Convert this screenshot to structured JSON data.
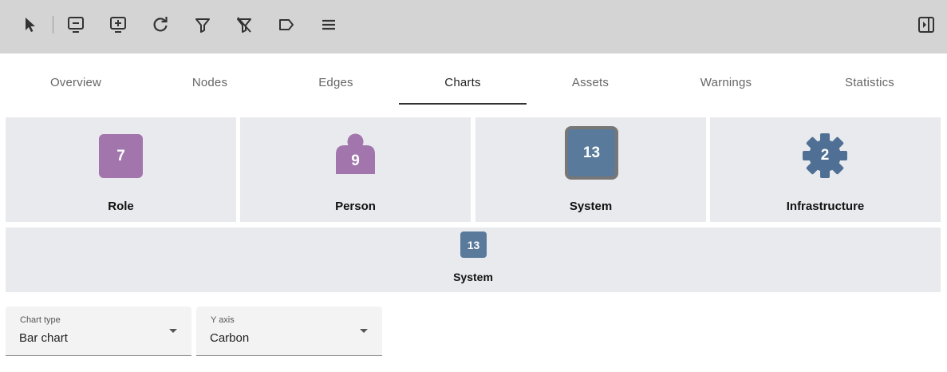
{
  "toolbar": {
    "icons": [
      "pointer-icon",
      "remove-screen-icon",
      "add-screen-icon",
      "refresh-icon",
      "filter-icon",
      "clear-filter-icon",
      "label-icon",
      "menu-icon",
      "toggle-panel-icon"
    ]
  },
  "tabs": [
    {
      "label": "Overview"
    },
    {
      "label": "Nodes"
    },
    {
      "label": "Edges"
    },
    {
      "label": "Charts"
    },
    {
      "label": "Assets"
    },
    {
      "label": "Warnings"
    },
    {
      "label": "Statistics"
    }
  ],
  "active_tab": "Charts",
  "cards": [
    {
      "label": "Role",
      "count": "7",
      "icon": "role-square-icon",
      "color": "#a275ac"
    },
    {
      "label": "Person",
      "count": "9",
      "icon": "person-icon",
      "color": "#a275ac"
    },
    {
      "label": "System",
      "count": "13",
      "icon": "system-square-icon",
      "color": "#5a7a9c"
    },
    {
      "label": "Infrastructure",
      "count": "2",
      "icon": "gear-icon",
      "color": "#4f7094"
    }
  ],
  "selected": {
    "label": "System",
    "count": "13",
    "color": "#5a7a9c"
  },
  "controls": {
    "chart_type": {
      "caption": "Chart type",
      "value": "Bar chart"
    },
    "y_axis": {
      "caption": "Y axis",
      "value": "Carbon"
    }
  },
  "colors": {
    "toolbar_bg": "#d4d4d4",
    "card_bg": "#e9eaee",
    "purple": "#a275ac",
    "blue": "#5a7a9c"
  }
}
